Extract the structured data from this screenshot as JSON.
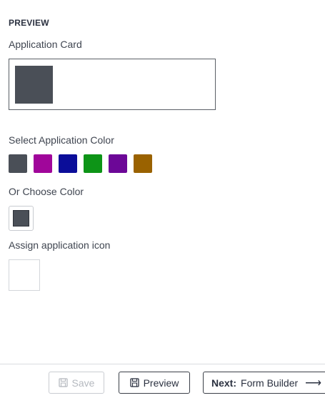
{
  "preview": {
    "title": "PREVIEW",
    "card_label": "Application Card",
    "select_color_label": "Select Application Color",
    "choose_color_label": "Or Choose Color",
    "assign_icon_label": "Assign application icon",
    "current_color": "#4a4f57"
  },
  "colors": [
    {
      "name": "slate",
      "hex": "#4a4f57"
    },
    {
      "name": "magenta",
      "hex": "#a0069a"
    },
    {
      "name": "navy",
      "hex": "#0b0d99"
    },
    {
      "name": "green",
      "hex": "#0d9417"
    },
    {
      "name": "purple",
      "hex": "#6c0797"
    },
    {
      "name": "amber",
      "hex": "#9a6200"
    }
  ],
  "footer": {
    "save_label": "Save",
    "preview_label": "Preview",
    "next_prefix": "Next:",
    "next_label": "Form Builder",
    "save_icon": "save-icon",
    "arrow_icon": "arrow-right-icon"
  }
}
